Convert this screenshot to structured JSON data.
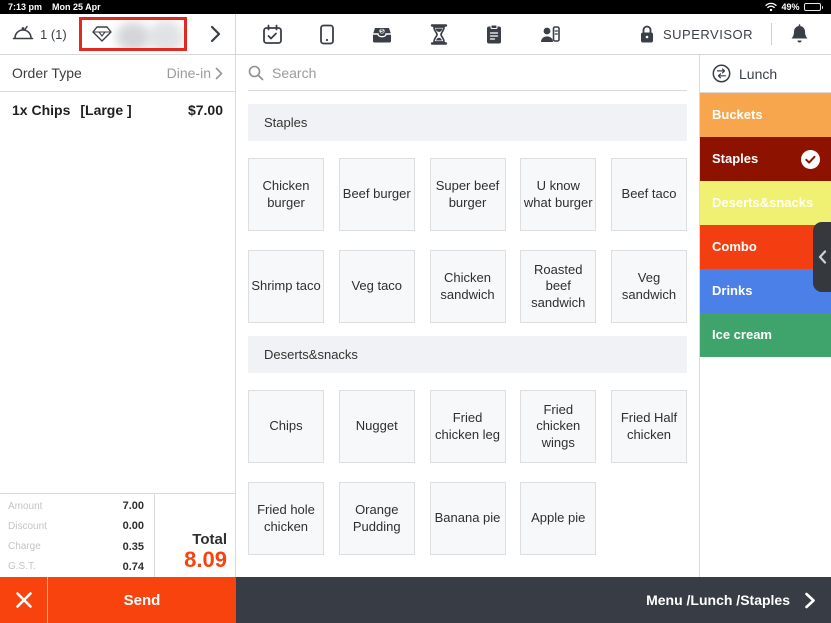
{
  "status_bar": {
    "time": "7:13 pm",
    "date": "Mon 25 Apr",
    "battery": "49%"
  },
  "toolbar": {
    "order_count": "1 (1)",
    "supervisor_label": "SUPERVISOR"
  },
  "order_panel": {
    "order_type_label": "Order Type",
    "order_type_value": "Dine-in",
    "items": [
      {
        "name": "1x Chips",
        "modifier": "[Large ]",
        "price": "$7.00"
      }
    ],
    "totals": [
      {
        "label": "Amount",
        "value": "7.00"
      },
      {
        "label": "Discount",
        "value": "0.00"
      },
      {
        "label": "Charge",
        "value": "0.35"
      },
      {
        "label": "G.S.T.",
        "value": "0.74"
      }
    ],
    "total_label": "Total",
    "total_value": "8.09"
  },
  "menu_panel": {
    "search_placeholder": "Search",
    "sections": [
      {
        "title": "Staples",
        "items": [
          "Chicken burger",
          "Beef burger",
          "Super beef burger",
          "U know what burger",
          "Beef taco",
          "Shrimp taco",
          "Veg taco",
          "Chicken sandwich",
          "Roasted beef sandwich",
          "Veg sandwich"
        ]
      },
      {
        "title": "Deserts&snacks",
        "items": [
          "Chips",
          "Nugget",
          "Fried chicken leg",
          "Fried chicken wings",
          "Fried Half chicken",
          "Fried hole chicken",
          "Orange Pudding",
          "Banana pie",
          "Apple pie"
        ]
      }
    ]
  },
  "category_panel": {
    "menu_name": "Lunch",
    "categories": [
      {
        "label": "Buckets",
        "color": "#F7A64E",
        "text_color": "#ffffff",
        "selected": false
      },
      {
        "label": "Staples",
        "color": "#8E1200",
        "text_color": "#ffffff",
        "selected": true
      },
      {
        "label": "Deserts&snacks",
        "color": "#F0F173",
        "text_color": "rgba(255,255,255,0.92)",
        "selected": false
      },
      {
        "label": "Combo",
        "color": "#F23E10",
        "text_color": "#ffffff",
        "selected": false
      },
      {
        "label": "Drinks",
        "color": "#4A80E8",
        "text_color": "#ffffff",
        "selected": false
      },
      {
        "label": "Ice cream",
        "color": "#3FA36C",
        "text_color": "#ffffff",
        "selected": false
      }
    ]
  },
  "bottom_bar": {
    "send_label": "Send",
    "breadcrumb": "Menu /Lunch /Staples"
  },
  "colors": {
    "accent": "#F8430F",
    "dark": "#3A3F47",
    "highlight_red": "#E02920"
  }
}
